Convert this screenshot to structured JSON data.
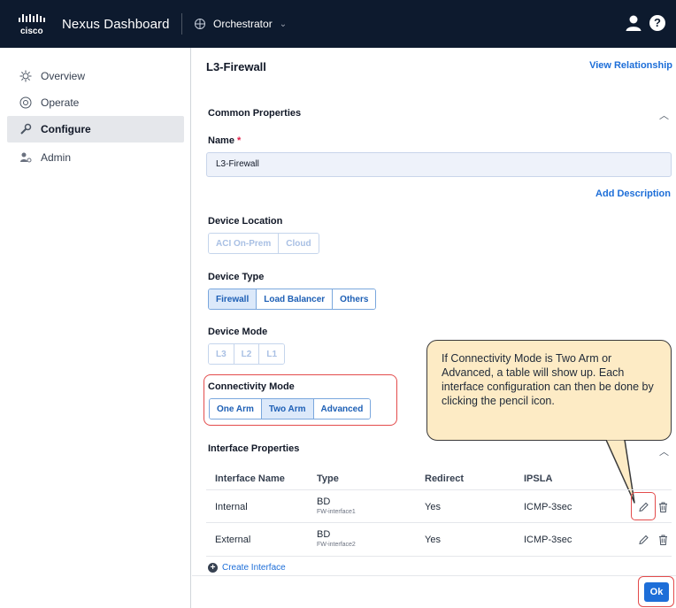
{
  "header": {
    "app_title": "Nexus Dashboard",
    "orchestrator_label": "Orchestrator",
    "logo_text": "cisco"
  },
  "sidebar": {
    "items": [
      {
        "label": "Overview",
        "icon": "overview-icon"
      },
      {
        "label": "Operate",
        "icon": "operate-icon"
      },
      {
        "label": "Configure",
        "icon": "wrench-icon",
        "active": true
      },
      {
        "label": "Admin",
        "icon": "admin-icon"
      }
    ]
  },
  "page": {
    "title": "L3-Firewall",
    "view_relationship": "View Relationship"
  },
  "common_properties": {
    "title": "Common Properties",
    "name_label": "Name",
    "name_required_mark": "*",
    "name_value": "L3-Firewall",
    "add_description": "Add Description",
    "device_location_label": "Device Location",
    "device_location_options": [
      "ACI On-Prem",
      "Cloud"
    ],
    "device_type_label": "Device Type",
    "device_type_options": [
      "Firewall",
      "Load Balancer",
      "Others"
    ],
    "device_type_selected": "Firewall",
    "device_mode_label": "Device Mode",
    "device_mode_options": [
      "L3",
      "L2",
      "L1"
    ],
    "connectivity_mode_label": "Connectivity Mode",
    "connectivity_mode_options": [
      "One Arm",
      "Two Arm",
      "Advanced"
    ],
    "connectivity_mode_selected": "Two Arm"
  },
  "callout": {
    "text": "If Connectivity Mode is Two Arm or Advanced, a table will show up. Each interface configuration can then be done by clicking the pencil icon."
  },
  "interface_properties": {
    "title": "Interface Properties",
    "columns": [
      "Interface Name",
      "Type",
      "Redirect",
      "IPSLA"
    ],
    "rows": [
      {
        "name": "Internal",
        "type": "BD",
        "type_sub": "FW-interface1",
        "redirect": "Yes",
        "ipsla": "ICMP-3sec"
      },
      {
        "name": "External",
        "type": "BD",
        "type_sub": "FW-interface2",
        "redirect": "Yes",
        "ipsla": "ICMP-3sec"
      }
    ],
    "create_interface": "Create Interface"
  },
  "footer": {
    "ok_label": "Ok"
  },
  "colors": {
    "header_bg": "#0d1a2e",
    "accent": "#1d6ed8",
    "highlight": "#e34b4b",
    "callout_bg": "#fdebc5"
  }
}
